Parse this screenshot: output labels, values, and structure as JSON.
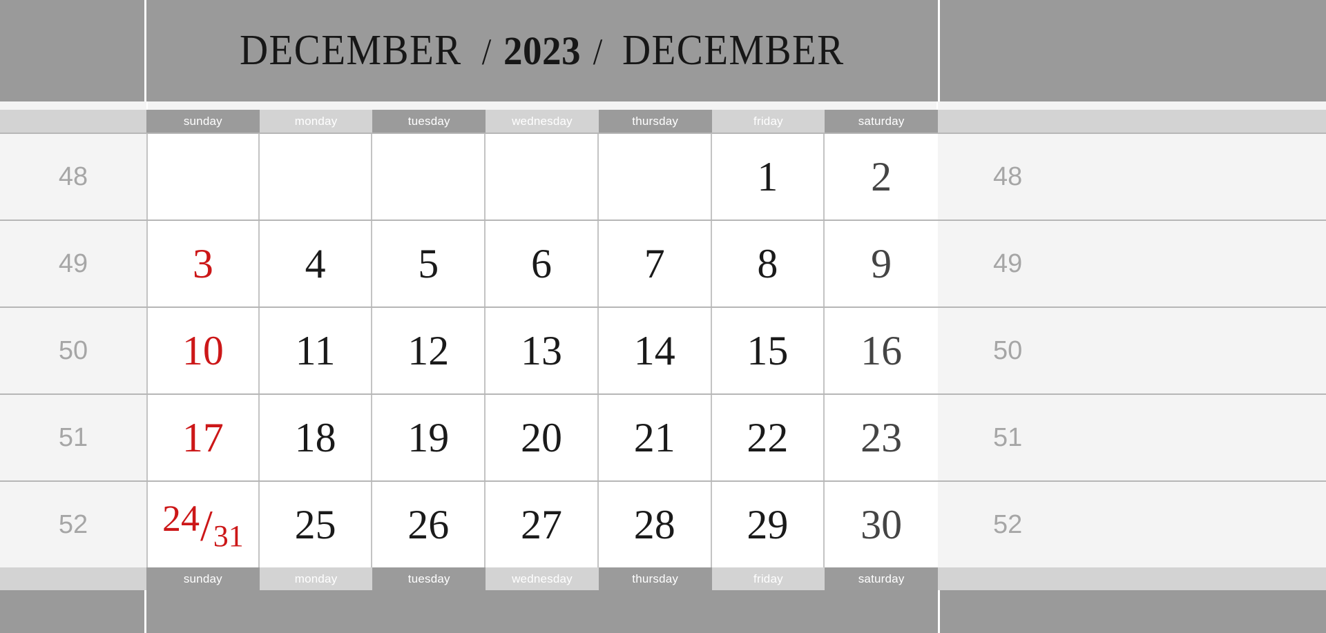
{
  "header": {
    "month_left": "DECEMBER",
    "separator": "/",
    "year": "2023",
    "month_right": "DECEMBER"
  },
  "colors": {
    "band_gray": "#9a9a9a",
    "weekday_dark": "#9b9b9b",
    "weekday_light": "#d3d3d3",
    "weeknum_bg": "#f4f4f4",
    "weeknum_text": "#a6a6a6",
    "sunday_red": "#cc1718",
    "saturday_gray": "#444444",
    "weekday_black": "#1a1a1a",
    "grid_line": "#c3c3c3"
  },
  "weekdays": [
    {
      "label": "sunday",
      "shade": "dark"
    },
    {
      "label": "monday",
      "shade": "light"
    },
    {
      "label": "tuesday",
      "shade": "dark"
    },
    {
      "label": "wednesday",
      "shade": "light"
    },
    {
      "label": "thursday",
      "shade": "dark"
    },
    {
      "label": "friday",
      "shade": "light"
    },
    {
      "label": "saturday",
      "shade": "dark"
    }
  ],
  "weeks": [
    {
      "number": "48",
      "days": [
        "",
        "",
        "",
        "",
        "",
        "1",
        "2"
      ]
    },
    {
      "number": "49",
      "days": [
        "3",
        "4",
        "5",
        "6",
        "7",
        "8",
        "9"
      ]
    },
    {
      "number": "50",
      "days": [
        "10",
        "11",
        "12",
        "13",
        "14",
        "15",
        "16"
      ]
    },
    {
      "number": "51",
      "days": [
        "17",
        "18",
        "19",
        "20",
        "21",
        "22",
        "23"
      ]
    },
    {
      "number": "52",
      "days": [
        "24/31",
        "25",
        "26",
        "27",
        "28",
        "29",
        "30"
      ],
      "first_day_fraction": {
        "numerator": "24",
        "slash": "/",
        "denominator": "31"
      }
    }
  ]
}
